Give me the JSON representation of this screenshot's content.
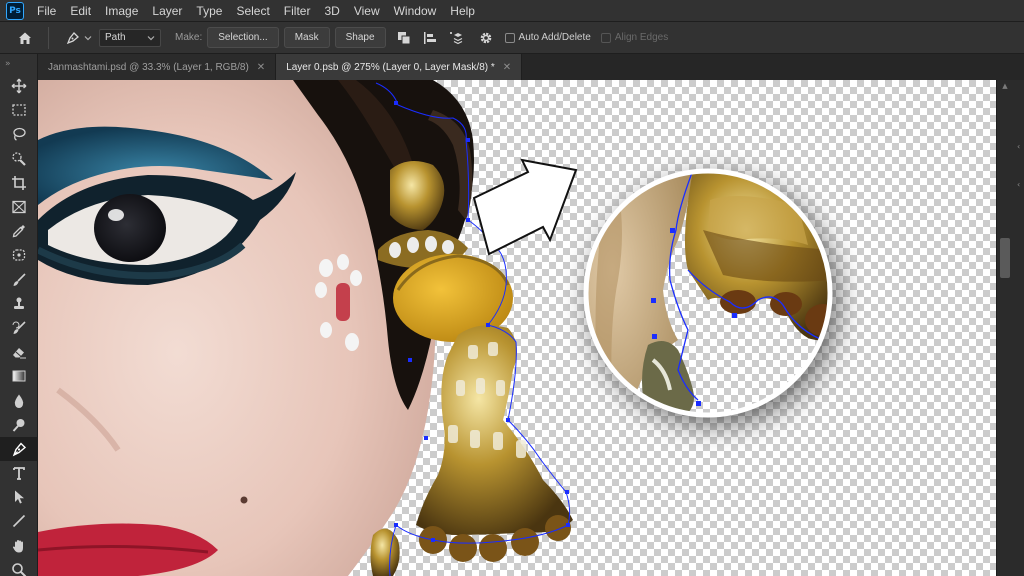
{
  "app": {
    "logo": "Ps"
  },
  "menu": [
    "File",
    "Edit",
    "Image",
    "Layer",
    "Type",
    "Select",
    "Filter",
    "3D",
    "View",
    "Window",
    "Help"
  ],
  "options": {
    "mode_value": "Path",
    "make_label": "Make:",
    "selection_btn": "Selection...",
    "mask_btn": "Mask",
    "shape_btn": "Shape",
    "auto_add_delete": "Auto Add/Delete",
    "align_edges": "Align Edges"
  },
  "tabs": [
    {
      "label": "Janmashtami.psd @ 33.3% (Layer 1, RGB/8)",
      "active": false
    },
    {
      "label": "Layer 0.psb @ 275% (Layer 0, Layer Mask/8) *",
      "active": true
    }
  ],
  "tools": [
    "move-tool-icon",
    "marquee-tool-icon",
    "lasso-tool-icon",
    "quick-select-tool-icon",
    "crop-tool-icon",
    "frame-tool-icon",
    "eyedropper-tool-icon",
    "healing-brush-tool-icon",
    "brush-tool-icon",
    "clone-stamp-tool-icon",
    "history-brush-tool-icon",
    "eraser-tool-icon",
    "gradient-tool-icon",
    "blur-tool-icon",
    "dodge-tool-icon",
    "pen-tool-icon",
    "type-tool-icon",
    "path-selection-tool-icon",
    "line-tool-icon",
    "hand-tool-icon",
    "zoom-tool-icon"
  ],
  "colors": {
    "accent": "#31a8ff",
    "path": "#1a2dff",
    "chrome": "#323232",
    "canvas_dark": "#2b2b2b"
  }
}
